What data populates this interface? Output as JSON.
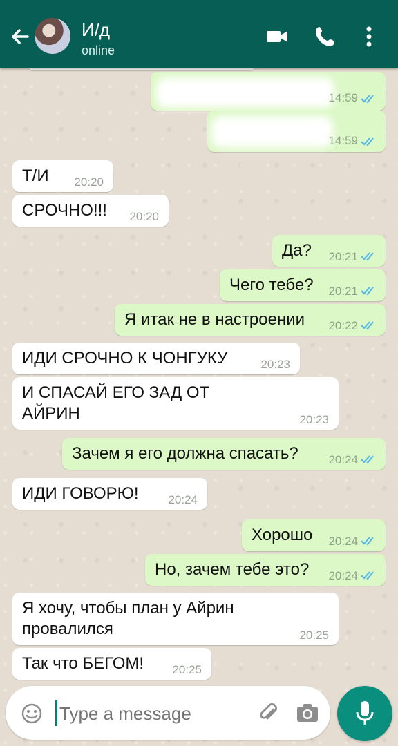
{
  "header": {
    "contact_name": "И/д",
    "status": "online",
    "icons": [
      "back-arrow-icon",
      "video-call-icon",
      "phone-icon",
      "more-vert-icon"
    ]
  },
  "messages": [
    {
      "dir": "out",
      "text": "",
      "time": "14:59",
      "ticks": "read",
      "blurred": true
    },
    {
      "dir": "out",
      "text": "",
      "time": "14:59",
      "ticks": "read",
      "blurred": true
    },
    {
      "dir": "in",
      "text": "Т/И",
      "time": "20:20"
    },
    {
      "dir": "in",
      "text": "СРОЧНО!!!",
      "time": "20:20"
    },
    {
      "dir": "out",
      "text": "Да?",
      "time": "20:21",
      "ticks": "read"
    },
    {
      "dir": "out",
      "text": "Чего тебе?",
      "time": "20:21",
      "ticks": "read"
    },
    {
      "dir": "out",
      "text": "Я итак не в настроении",
      "time": "20:22",
      "ticks": "read"
    },
    {
      "dir": "in",
      "text": "ИДИ СРОЧНО К ЧОНГУКУ",
      "time": "20:23"
    },
    {
      "dir": "in",
      "text": "И СПАСАЙ ЕГО ЗАД ОТ АЙРИН",
      "time": "20:23"
    },
    {
      "dir": "out",
      "text": "Зачем я его должна спасать?",
      "time": "20:24",
      "ticks": "read"
    },
    {
      "dir": "in",
      "text": "ИДИ ГОВОРЮ!",
      "time": "20:24"
    },
    {
      "dir": "out",
      "text": "Хорошо",
      "time": "20:24",
      "ticks": "read"
    },
    {
      "dir": "out",
      "text": "Но, зачем тебе это?",
      "time": "20:24",
      "ticks": "read"
    },
    {
      "dir": "in",
      "text": "Я хочу, чтобы план у Айрин провалился",
      "time": "20:25"
    },
    {
      "dir": "in",
      "text": "Так что БЕГОМ!",
      "time": "20:25"
    }
  ],
  "composer": {
    "placeholder": "Type a message",
    "icons": [
      "emoji-icon",
      "attach-icon",
      "camera-icon",
      "mic-icon"
    ]
  },
  "colors": {
    "header": "#075e54",
    "outgoing_bubble": "#dcf8c6",
    "incoming_bubble": "#ffffff",
    "read_ticks": "#4fb6ec",
    "mic_button": "#0a8f7e"
  }
}
